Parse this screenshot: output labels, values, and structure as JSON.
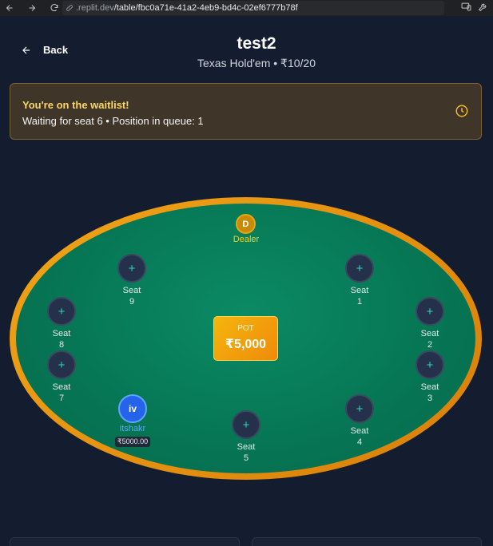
{
  "browser": {
    "url_host": ".replit.dev",
    "url_path": "/table/fbc0a71e-41a2-4eb9-bd4c-02ef6777b78f"
  },
  "header": {
    "back_label": "Back",
    "title": "test2",
    "subtitle": "Texas Hold'em • ₹10/20"
  },
  "waitlist": {
    "title": "You're on the waitlist!",
    "message": "Waiting for seat 6 • Position in queue: 1"
  },
  "table": {
    "dealer_chip": "D",
    "dealer_label": "Dealer",
    "pot_label": "POT",
    "pot_amount": "₹5,000",
    "seats": [
      {
        "word": "Seat",
        "number": "1",
        "icon": "+"
      },
      {
        "word": "Seat",
        "number": "2",
        "icon": "+"
      },
      {
        "word": "Seat",
        "number": "3",
        "icon": "+"
      },
      {
        "word": "Seat",
        "number": "4",
        "icon": "+"
      },
      {
        "word": "Seat",
        "number": "5",
        "icon": "+"
      },
      {
        "word": "Seat",
        "number": "7",
        "icon": "+"
      },
      {
        "word": "Seat",
        "number": "8",
        "icon": "+"
      },
      {
        "word": "Seat",
        "number": "9",
        "icon": "+"
      }
    ],
    "player": {
      "initials": "iv",
      "name": "itshakr",
      "stack": "₹5000.00"
    }
  },
  "colors": {
    "background": "#141c2f",
    "felt": "#067553",
    "rim": "#f0a417",
    "accent_gold": "#fbd566",
    "player_blue": "#2563eb"
  }
}
